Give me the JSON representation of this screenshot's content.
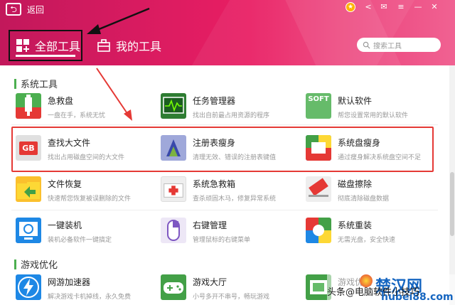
{
  "header": {
    "back_label": "返回",
    "tabs": [
      {
        "label": "全部工具",
        "active": true
      },
      {
        "label": "我的工具",
        "active": false
      }
    ],
    "search_placeholder": "搜索工具",
    "colors": {
      "gradient_start": "#c2185b",
      "gradient_end": "#f06292"
    }
  },
  "sections": [
    {
      "title": "系统工具"
    },
    {
      "title": "游戏优化"
    }
  ],
  "tools": [
    {
      "name": "急救盘",
      "desc": "一盘在手，系统无忧",
      "icon": "usb-rescue-icon",
      "color": "#4caf50"
    },
    {
      "name": "任务管理器",
      "desc": "找出自前最占用资源的程序",
      "icon": "task-manager-icon",
      "color": "#2e7d32"
    },
    {
      "name": "默认软件",
      "desc": "帮您设置常用的默认软件",
      "icon": "soft-default-icon",
      "color": "#66bb6a"
    },
    {
      "name": "查找大文件",
      "desc": "找出占用磁盘空间的大文件",
      "icon": "gb-file-icon",
      "color": "#e53935"
    },
    {
      "name": "注册表瘦身",
      "desc": "清理无效、错误的注册表键值",
      "icon": "registry-icon",
      "color": "#5c6bc0"
    },
    {
      "name": "系统盘瘦身",
      "desc": "通过瘦身解决系统盘空间不足",
      "icon": "disk-slim-icon",
      "color": "#1e88e5"
    },
    {
      "name": "文件恢复",
      "desc": "快速帮您恢复被误删除的文件",
      "icon": "file-restore-icon",
      "color": "#fbc02d"
    },
    {
      "name": "系统急救箱",
      "desc": "查杀顽固木马，修复异常系统",
      "icon": "first-aid-icon",
      "color": "#e0e0e0"
    },
    {
      "name": "磁盘擦除",
      "desc": "彻底清除磁盘数据",
      "icon": "disk-erase-icon",
      "color": "#e0e0e0"
    },
    {
      "name": "一键装机",
      "desc": "装机必备软件一键搞定",
      "icon": "install-icon",
      "color": "#1e88e5"
    },
    {
      "name": "右键管理",
      "desc": "管理鼠标的右键菜单",
      "icon": "mouse-icon",
      "color": "#7e57c2"
    },
    {
      "name": "系统重装",
      "desc": "无需光盘，安全快速",
      "icon": "windows-icon",
      "color": "#e53935"
    },
    {
      "name": "网游加速器",
      "desc": "解决游戏卡机掉线，永久免费",
      "icon": "lightning-icon",
      "color": "#1e88e5"
    },
    {
      "name": "游戏大厅",
      "desc": "小号多开不串号，畅玩游戏",
      "icon": "gamepad-icon",
      "color": "#43a047"
    },
    {
      "name": "游戏优化",
      "desc": "",
      "icon": "game-boost-icon",
      "color": "#43a047"
    }
  ],
  "watermark": {
    "site": "楚汉网",
    "domain": "hubei88.com",
    "caption": "头条@电脑软件小技巧"
  }
}
